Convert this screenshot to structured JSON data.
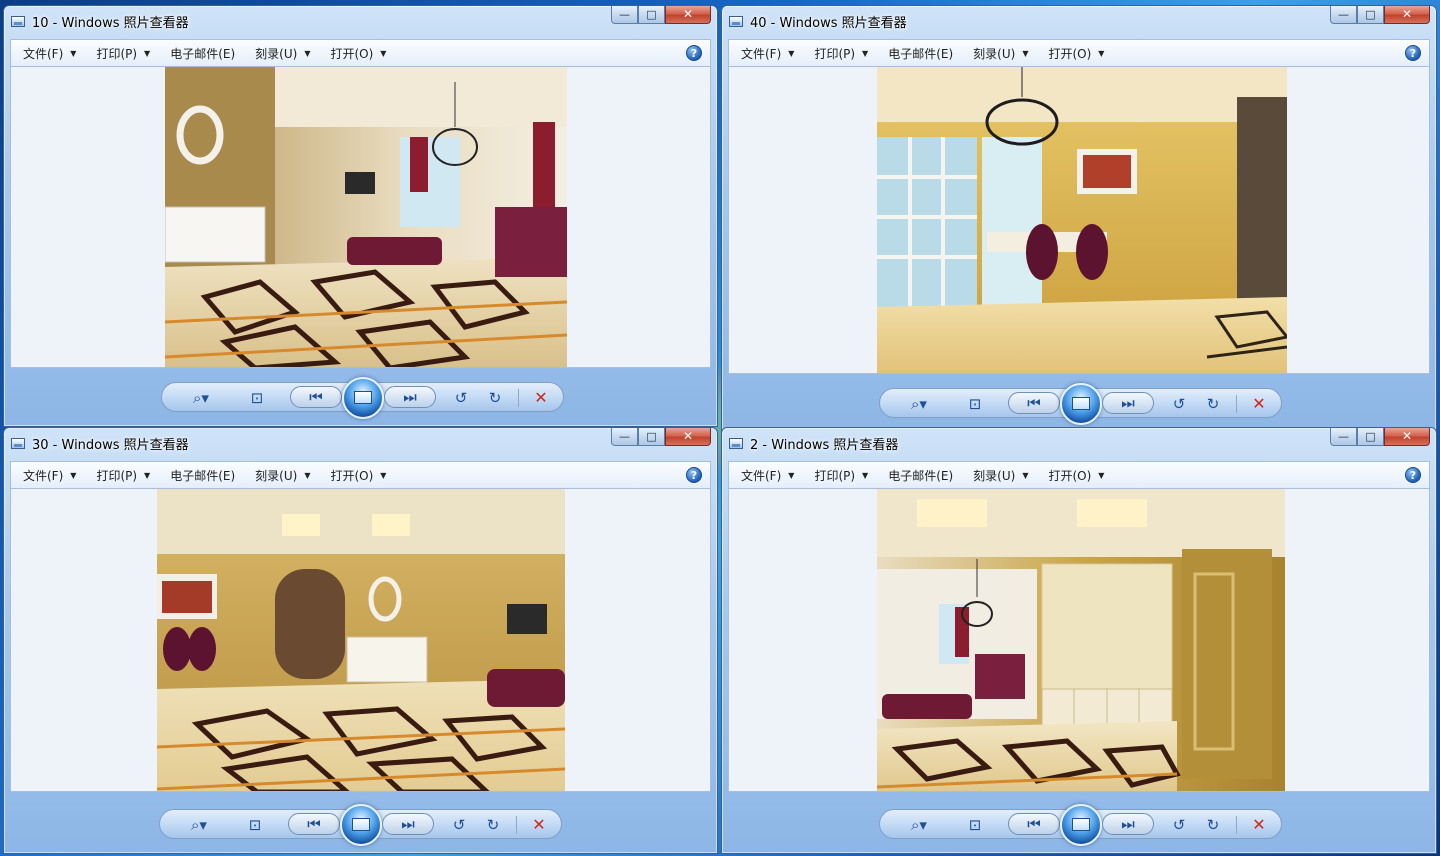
{
  "windows": [
    {
      "id": "w1",
      "title": "10 - Windows 照片查看器",
      "menu": [
        "文件(F)",
        "打印(P)",
        "电子邮件(E)",
        "刻录(U)",
        "打开(O)"
      ],
      "photo_scene": "living-room"
    },
    {
      "id": "w2",
      "title": "40 - Windows 照片查看器",
      "menu": [
        "文件(F)",
        "打印(P)",
        "电子邮件(E)",
        "刻录(U)",
        "打开(O)"
      ],
      "photo_scene": "dining-room"
    },
    {
      "id": "w3",
      "title": "30 - Windows 照片查看器",
      "menu": [
        "文件(F)",
        "打印(P)",
        "电子邮件(E)",
        "刻录(U)",
        "打开(O)"
      ],
      "photo_scene": "hallway"
    },
    {
      "id": "w4",
      "title": "2 - Windows 照片查看器",
      "menu": [
        "文件(F)",
        "打印(P)",
        "电子邮件(E)",
        "刻录(U)",
        "打开(O)"
      ],
      "photo_scene": "entrance"
    }
  ],
  "caption_buttons": {
    "minimize": "—",
    "maximize": "□",
    "close": "✕"
  },
  "help": "?",
  "controls": {
    "zoom": "zoom-icon",
    "fit": "actual-size-icon",
    "previous": "previous-icon",
    "slideshow": "slideshow-icon",
    "next": "next-icon",
    "rotate_ccw": "rotate-counterclockwise-icon",
    "rotate_cw": "rotate-clockwise-icon",
    "delete": "delete-icon"
  },
  "colors": {
    "desktop_blue": "#1667c9",
    "window_frame": "#a9c9ee",
    "viewer_bg": "#eef3fa",
    "delete_red": "#d0261a",
    "burgundy": "#7a1f3d",
    "gold_wall": "#c9a64a"
  }
}
